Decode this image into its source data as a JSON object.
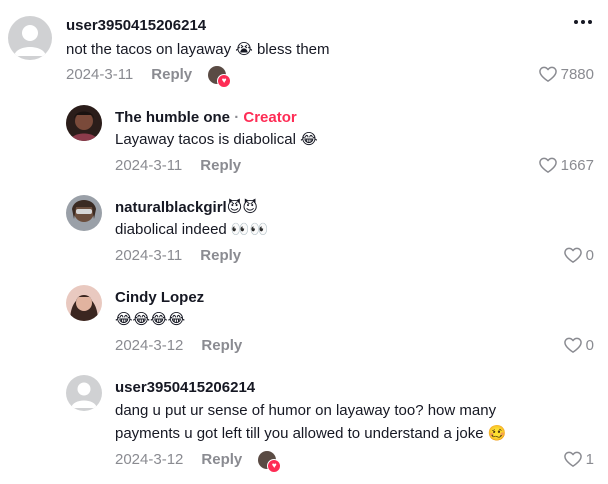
{
  "comments": [
    {
      "username": "user3950415206214",
      "text": "not the tacos on layaway 😭 bless them",
      "date": "2024-3-11",
      "reply_label": "Reply",
      "likes": "7880",
      "avatar": "default-avatar-icon",
      "has_creator_like": true
    },
    {
      "username": "The humble one",
      "creator_sep": "·",
      "creator_label": "Creator",
      "text": "Layaway tacos is diabolical 😂",
      "date": "2024-3-11",
      "reply_label": "Reply",
      "likes": "1667",
      "avatar": "profile-photo"
    },
    {
      "username": "naturalblackgirl😈😈",
      "text": "diabolical indeed 👀👀",
      "date": "2024-3-11",
      "reply_label": "Reply",
      "likes": "0",
      "avatar": "profile-photo"
    },
    {
      "username": "Cindy Lopez",
      "text": "😂😂😂😂",
      "date": "2024-3-12",
      "reply_label": "Reply",
      "likes": "0",
      "avatar": "profile-photo"
    },
    {
      "username": "user3950415206214",
      "text_line1": "dang u put ur sense of humor on layaway too? how many",
      "text_line2": "payments u got left till you allowed to understand a joke 🥴",
      "date": "2024-3-12",
      "reply_label": "Reply",
      "likes": "1",
      "avatar": "default-avatar-icon",
      "has_creator_like": true
    }
  ],
  "icons": {
    "more": "more-options-icon",
    "like": "heart-outline-icon"
  },
  "colors": {
    "creator": "#fe2c55",
    "secondary_text": "#8a8b91",
    "primary_text": "#161823"
  }
}
